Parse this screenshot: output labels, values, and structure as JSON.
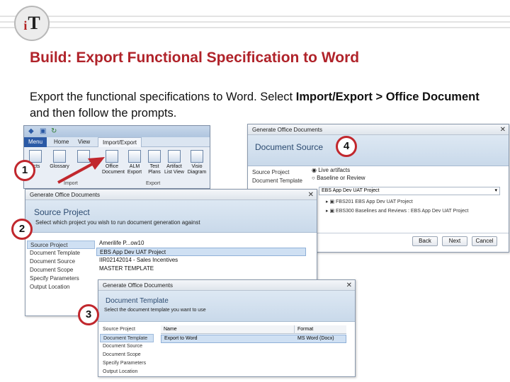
{
  "logo": {
    "text_i": "i",
    "text_t": "T"
  },
  "slide": {
    "title": "Build: Export Functional Specification to Word",
    "body_pre": "Export the functional specifications to Word.  Select ",
    "body_bold1": "Import/Export > Office Document",
    "body_mid": " and then follow the prompts."
  },
  "ribbon": {
    "tabs": [
      "Menu",
      "Home",
      "View",
      "Import/Export"
    ],
    "buttons": [
      {
        "label": "ects",
        "icon": "document-icon"
      },
      {
        "label": "Glossary",
        "icon": "book-icon"
      },
      {
        "label": "",
        "icon": "import-icon"
      },
      {
        "label": "Office Document",
        "icon": "office-document-icon"
      },
      {
        "label": "ALM Export",
        "icon": "alm-icon"
      },
      {
        "label": "Test Plans",
        "icon": "test-plan-icon"
      },
      {
        "label": "Artifact List View",
        "icon": "artifact-icon"
      },
      {
        "label": "Visio Diagram",
        "icon": "visio-icon"
      }
    ],
    "group_import": "Import",
    "group_export": "Export"
  },
  "dlg_source": {
    "window_title": "Generate Office Documents",
    "header_title": "Source Project",
    "header_sub": "Select which project you wish to run document generation against",
    "nav": [
      "Source Project",
      "Document Template",
      "Document Source",
      "Document Scope",
      "Specify Parameters",
      "Output Location"
    ],
    "projects": [
      "Amerilife P...ow10",
      "EBS App Dev UAT Project",
      "IIR02142014 - Sales Incentives",
      "MASTER TEMPLATE"
    ]
  },
  "dlg_template": {
    "window_title": "Generate Office Documents",
    "header_title": "Document Template",
    "header_sub": "Select the document template you want to use",
    "nav": [
      "Source Project",
      "Document Template",
      "Document Source",
      "Document Scope",
      "Specify Parameters",
      "Output Location"
    ],
    "col_name": "Name",
    "col_format": "Format",
    "row_name": "Export to Word",
    "row_format": "MS Word (Docx)"
  },
  "dlg_docsource": {
    "window_title": "Generate Office Documents",
    "header_title": "Document Source",
    "nav": [
      "Source Project",
      "Document Template"
    ],
    "radio_live": "Live artifacts",
    "radio_baseline": "Baseline or Review",
    "dropdown": "EBS App Dev UAT Project",
    "tree": [
      "FBS201 EBS App Dev UAT Project",
      "EBS300 Baselines and Reviews : EBS App Dev UAT Project"
    ],
    "back": "Back",
    "next": "Next",
    "cancel": "Cancel"
  },
  "markers": [
    "1",
    "2",
    "3",
    "4"
  ],
  "colors": {
    "title": "#b0232a",
    "marker_border": "#c1272d",
    "arrow": "#c1272d"
  }
}
